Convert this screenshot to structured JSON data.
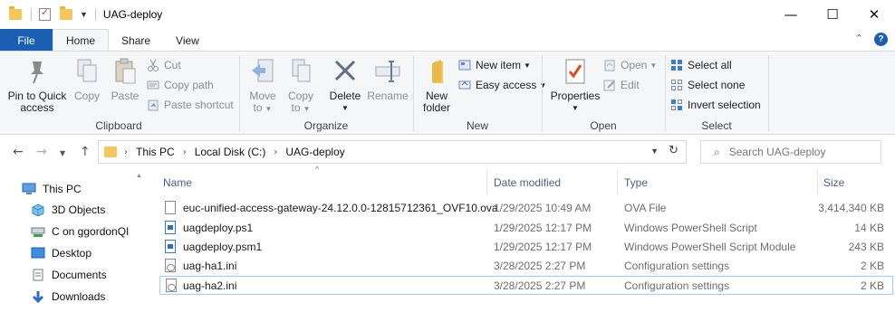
{
  "window": {
    "title": "UAG-deploy",
    "controls": {
      "minimize": "—",
      "maximize": "☐",
      "close": "✕"
    }
  },
  "ribbon_tabs": {
    "file": "File",
    "home": "Home",
    "share": "Share",
    "view": "View",
    "active": "Home"
  },
  "ribbon": {
    "clipboard": {
      "label": "Clipboard",
      "pin_line1": "Pin to Quick",
      "pin_line2": "access",
      "copy": "Copy",
      "paste": "Paste",
      "cut": "Cut",
      "copy_path": "Copy path",
      "paste_shortcut": "Paste shortcut"
    },
    "organize": {
      "label": "Organize",
      "move_to_line1": "Move",
      "move_to_line2": "to",
      "copy_to_line1": "Copy",
      "copy_to_line2": "to",
      "delete": "Delete",
      "rename": "Rename"
    },
    "new": {
      "label": "New",
      "new_folder_line1": "New",
      "new_folder_line2": "folder",
      "new_item": "New item",
      "easy_access": "Easy access"
    },
    "open": {
      "label": "Open",
      "properties": "Properties",
      "open": "Open",
      "edit": "Edit"
    },
    "select": {
      "label": "Select",
      "select_all": "Select all",
      "select_none": "Select none",
      "invert_selection": "Invert selection"
    }
  },
  "address": {
    "crumbs": [
      "This PC",
      "Local Disk (C:)",
      "UAG-deploy"
    ],
    "search_placeholder": "Search UAG-deploy"
  },
  "nav_pane": {
    "items": [
      "This PC",
      "3D Objects",
      "C on ggordonQI",
      "Desktop",
      "Documents",
      "Downloads"
    ]
  },
  "columns": {
    "name": "Name",
    "date": "Date modified",
    "type": "Type",
    "size": "Size"
  },
  "files": [
    {
      "name": "euc-unified-access-gateway-24.12.0.0-12815712361_OVF10.ova",
      "date": "1/29/2025 10:49 AM",
      "type": "OVA File",
      "size": "3,414,340 KB",
      "icon": "file-icon"
    },
    {
      "name": "uagdeploy.ps1",
      "date": "1/29/2025 12:17 PM",
      "type": "Windows PowerShell Script",
      "size": "14 KB",
      "icon": "powershell-script-icon"
    },
    {
      "name": "uagdeploy.psm1",
      "date": "1/29/2025 12:17 PM",
      "type": "Windows PowerShell Script Module",
      "size": "243 KB",
      "icon": "powershell-module-icon"
    },
    {
      "name": "uag-ha1.ini",
      "date": "3/28/2025 2:27 PM",
      "type": "Configuration settings",
      "size": "2 KB",
      "icon": "config-file-icon"
    },
    {
      "name": "uag-ha2.ini",
      "date": "3/28/2025 2:27 PM",
      "type": "Configuration settings",
      "size": "2 KB",
      "icon": "config-file-icon"
    }
  ],
  "colors": {
    "file_tab": "#1a5fb4",
    "selection_border": "#99d1ff",
    "folder": "#f4c75c"
  }
}
